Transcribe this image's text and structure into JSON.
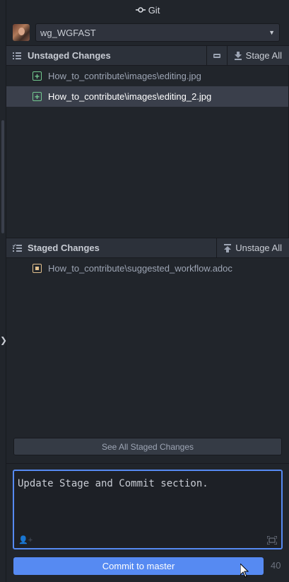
{
  "header": {
    "title": "Git",
    "icon": "git-commit-icon"
  },
  "repo": {
    "selected": "wg_WGFAST"
  },
  "unstaged": {
    "title": "Unstaged Changes",
    "stage_all_label": "Stage All",
    "files": [
      {
        "path": "How_to_contribute\\images\\editing.jpg",
        "status": "added"
      },
      {
        "path": "How_to_contribute\\images\\editing_2.jpg",
        "status": "added",
        "selected": true
      }
    ]
  },
  "staged": {
    "title": "Staged Changes",
    "unstage_all_label": "Unstage All",
    "files": [
      {
        "path": "How_to_contribute\\suggested_workflow.adoc",
        "status": "modified"
      }
    ]
  },
  "see_all_label": "See All Staged Changes",
  "commit": {
    "message": "Update Stage and Commit section.",
    "button_label": "Commit to master",
    "remaining_chars": "40"
  },
  "colors": {
    "accent": "#568af2",
    "added": "#73c990",
    "modified": "#e2c08d",
    "background": "#21252b"
  }
}
